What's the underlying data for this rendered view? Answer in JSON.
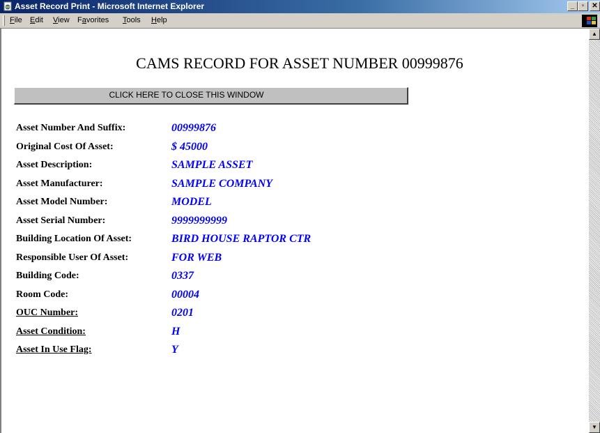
{
  "window": {
    "title": "Asset Record Print - Microsoft Internet Explorer",
    "controls": [
      "_",
      "▫",
      "✕"
    ]
  },
  "menu": {
    "items": [
      {
        "pre": "",
        "key": "F",
        "post": "ile"
      },
      {
        "pre": "",
        "key": "E",
        "post": "dit"
      },
      {
        "pre": "",
        "key": "V",
        "post": "iew"
      },
      {
        "pre": "F",
        "key": "a",
        "post": "vorites"
      },
      {
        "pre": "",
        "key": "T",
        "post": "ools"
      },
      {
        "pre": "",
        "key": "H",
        "post": "elp"
      }
    ]
  },
  "page": {
    "heading": "CAMS RECORD FOR ASSET NUMBER 00999876",
    "close_button": "CLICK HERE TO CLOSE THIS WINDOW"
  },
  "fields": [
    {
      "label": "Asset Number And Suffix:",
      "value": "00999876",
      "underline": false
    },
    {
      "label": "Original Cost Of Asset:",
      "value": "$ 45000",
      "underline": false
    },
    {
      "label": "Asset Description:",
      "value": "SAMPLE ASSET",
      "underline": false
    },
    {
      "label": "Asset Manufacturer:",
      "value": "SAMPLE COMPANY",
      "underline": false
    },
    {
      "label": "Asset Model Number:",
      "value": "MODEL",
      "underline": false
    },
    {
      "label": "Asset Serial Number:",
      "value": "9999999999",
      "underline": false
    },
    {
      "label": "Building Location Of Asset:",
      "value": "BIRD HOUSE RAPTOR CTR",
      "underline": false
    },
    {
      "label": "Responsible User Of Asset:",
      "value": "FOR WEB",
      "underline": false
    },
    {
      "label": "Building Code:",
      "value": "0337",
      "underline": false
    },
    {
      "label": "Room Code:",
      "value": "00004",
      "underline": false
    },
    {
      "label": "OUC Number:",
      "value": "0201",
      "underline": true
    },
    {
      "label": "Asset Condition:",
      "value": "H",
      "underline": true
    },
    {
      "label": "Asset In Use Flag:",
      "value": "Y",
      "underline": true
    }
  ],
  "colors": {
    "titlebar": "#0a246a",
    "value_text": "#0000ff",
    "chrome": "#d4d0c8"
  }
}
